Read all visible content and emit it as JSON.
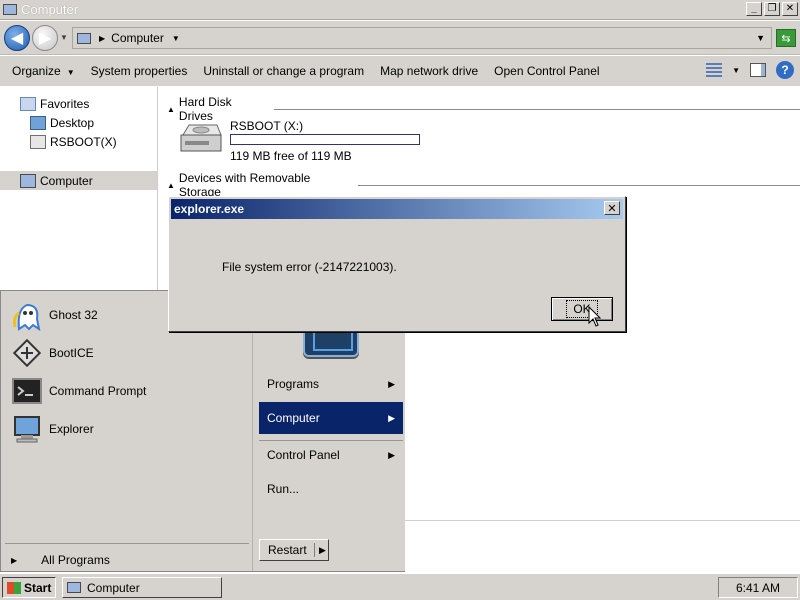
{
  "window": {
    "title": "Computer"
  },
  "address": {
    "crumb": "Computer"
  },
  "toolbar": {
    "organize": "Organize",
    "system_properties": "System properties",
    "uninstall": "Uninstall or change a program",
    "map_drive": "Map network drive",
    "control_panel": "Open Control Panel"
  },
  "navpane": {
    "favorites": "Favorites",
    "desktop": "Desktop",
    "rsboot": "RSBOOT(X)",
    "computer": "Computer"
  },
  "content": {
    "hdd_header": "Hard Disk Drives",
    "removable_header": "Devices with Removable Storage",
    "drive": {
      "name": "RSBOOT (X:)",
      "free_text": "119 MB free of 119 MB",
      "used_fraction": 0.0
    }
  },
  "dialog": {
    "title": "explorer.exe",
    "close": "X",
    "message": "File system error (-2147221003).",
    "ok": "OK"
  },
  "startmenu": {
    "pinned": [
      {
        "label": "Ghost 32",
        "icon": "ghost-icon"
      },
      {
        "label": "BootICE",
        "icon": "booticE-icon"
      },
      {
        "label": "Command Prompt",
        "icon": "cmd-icon"
      },
      {
        "label": "Explorer",
        "icon": "explorer-icon"
      }
    ],
    "all_programs": "All Programs",
    "right": {
      "programs": "Programs",
      "computer": "Computer",
      "control_panel": "Control Panel",
      "run": "Run..."
    },
    "restart": "Restart"
  },
  "taskbar": {
    "start": "Start",
    "task": "Computer",
    "clock": "6:41 AM"
  },
  "colors": {
    "window_bg": "#d6d3ce",
    "dialog_title": "#0a246a",
    "selection": "#0a246a"
  }
}
